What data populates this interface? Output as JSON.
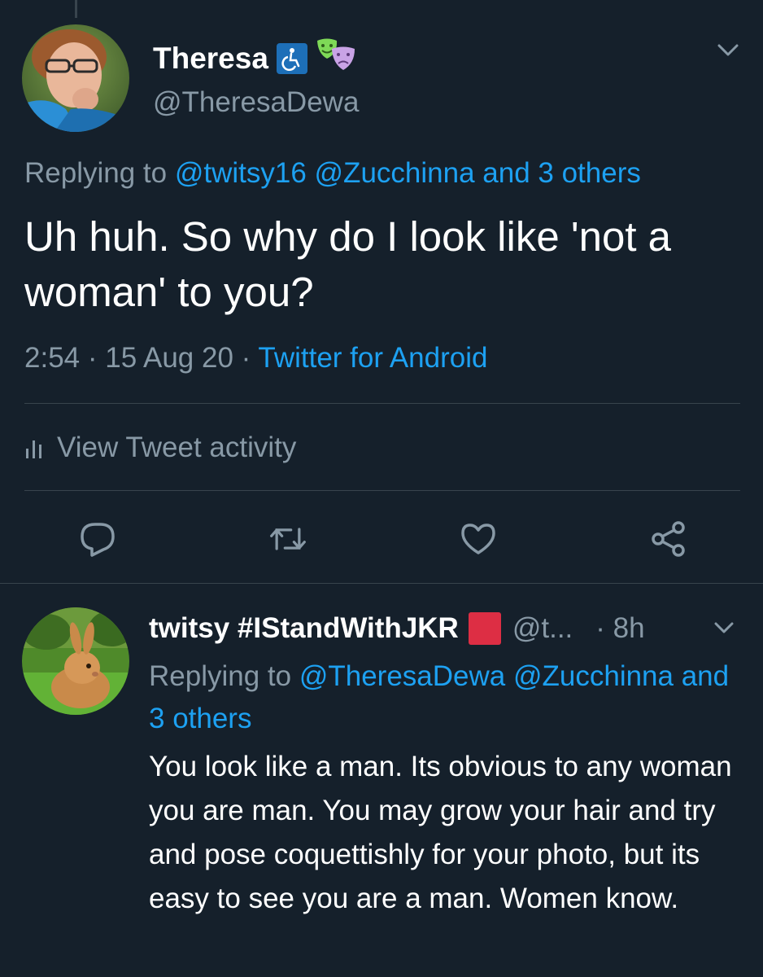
{
  "main_tweet": {
    "display_name": "Theresa",
    "handle": "@TheresaDewa",
    "replying_prefix": "Replying to",
    "replying_mentions": "@twitsy16 @Zucchinna and 3 others",
    "text": "Uh huh. So why do I look like 'not a woman' to you?",
    "time": "2:54",
    "date": "15 Aug 20",
    "source": "Twitter for Android",
    "separator": "·",
    "activity_label": "View Tweet activity",
    "badges": [
      "wheelchair-icon",
      "theater-masks-icon"
    ]
  },
  "reply_tweet": {
    "display_name": "twitsy #IStandWithJKR",
    "handle": "@t...",
    "time": "· 8h",
    "replying_prefix": "Replying to",
    "replying_mentions": "@TheresaDewa @Zucchinna and 3 others",
    "text": "You look like a man. Its obvious to any woman you are man. You may grow your hair and try and pose coquettishly for your photo, but its easy to see you are a man. Women know.",
    "badge": "red-square-icon"
  },
  "actions": [
    "reply-icon",
    "retweet-icon",
    "like-icon",
    "share-icon"
  ],
  "colors": {
    "background": "#15202b",
    "text": "#ffffff",
    "secondary": "#8899a6",
    "link": "#1da1f2",
    "divider": "#38444d",
    "badge_red": "#dd2e44"
  }
}
